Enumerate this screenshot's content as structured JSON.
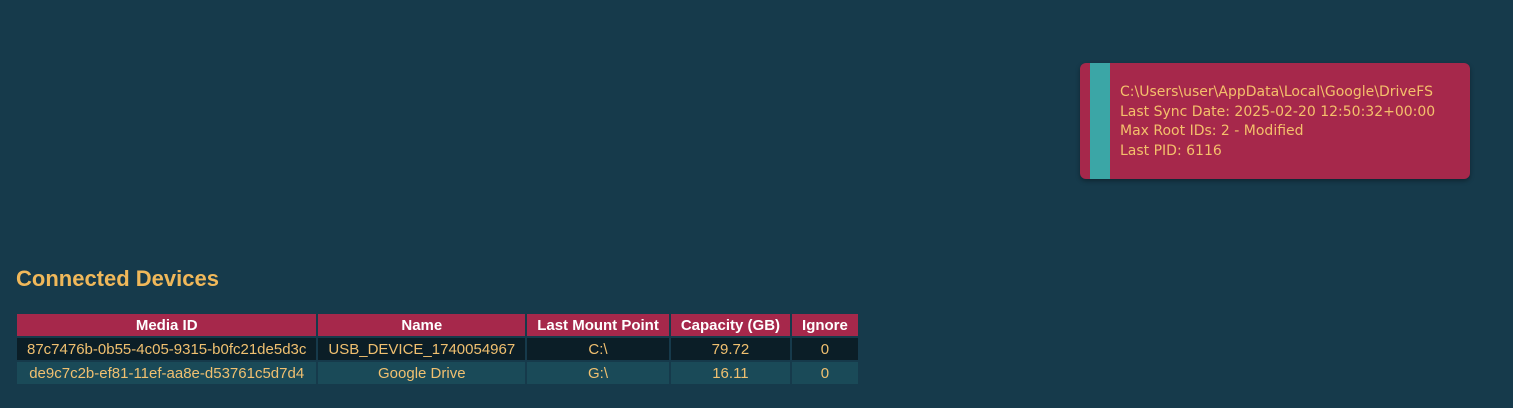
{
  "info_card": {
    "path": "C:\\Users\\user\\AppData\\Local\\Google\\DriveFS",
    "last_sync": "Last Sync Date: 2025-02-20 12:50:32+00:00",
    "max_root_ids": "Max Root IDs: 2 - Modified",
    "last_pid": "Last PID: 6116"
  },
  "section_title": "Connected Devices",
  "table": {
    "headers": [
      "Media ID",
      "Name",
      "Last Mount Point",
      "Capacity (GB)",
      "Ignore"
    ],
    "rows": [
      [
        "87c7476b-0b55-4c05-9315-b0fc21de5d3c",
        "USB_DEVICE_1740054967",
        "C:\\",
        "79.72",
        "0"
      ],
      [
        "de9c7c2b-ef81-11ef-aa8e-d53761c5d7d4",
        "Google Drive",
        "G:\\",
        "16.11",
        "0"
      ]
    ]
  },
  "colors": {
    "background": "#163a4b",
    "accent": "#a6284b",
    "stripe": "#3ba6a6",
    "text_gold": "#f0b85a"
  }
}
